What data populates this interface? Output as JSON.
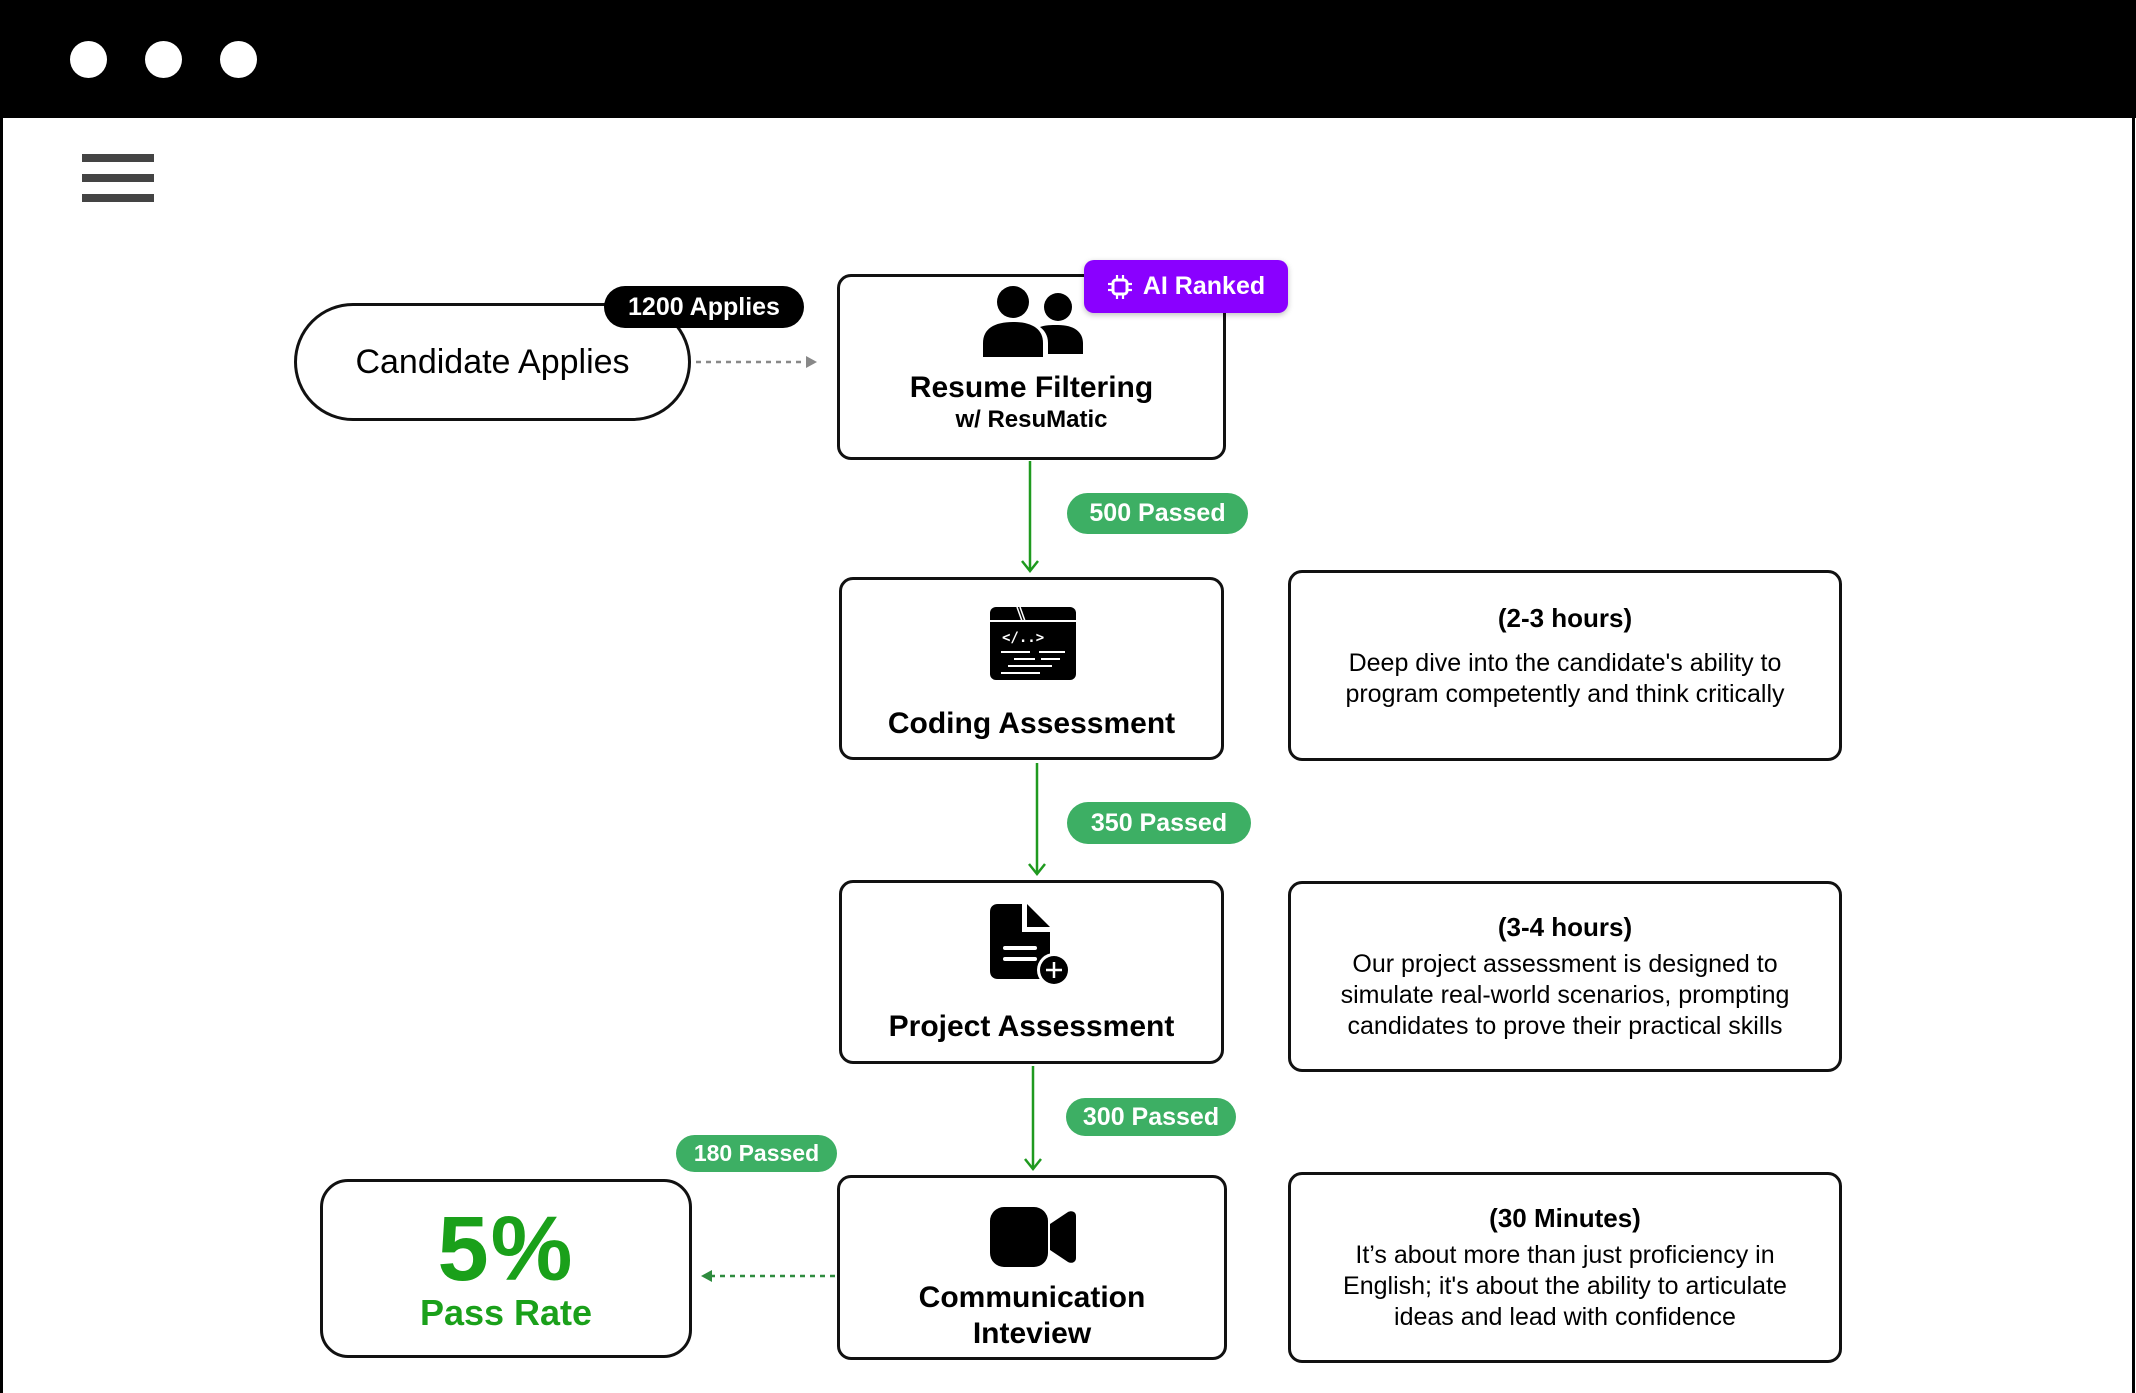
{
  "window": {
    "controls": [
      "window-dot",
      "window-dot",
      "window-dot"
    ],
    "menu_icon": "hamburger-menu-icon"
  },
  "flow": {
    "start": {
      "label": "Candidate Applies",
      "badge": "1200 Applies"
    },
    "steps": [
      {
        "title": "Resume Filtering",
        "subtitle": "w/ ResuMatic",
        "icon": "users-icon",
        "badge": {
          "icon": "chip-icon",
          "label": "AI Ranked",
          "color": "#8a00ff"
        }
      },
      {
        "title": "Coding Assessment",
        "icon": "code-window-icon",
        "code_glyph": "</..>"
      },
      {
        "title": "Project Assessment",
        "icon": "document-add-icon"
      },
      {
        "title": "Communication",
        "title_line2": "Inteview",
        "icon": "video-camera-icon"
      }
    ],
    "transitions": [
      {
        "label": "500 Passed"
      },
      {
        "label": "350 Passed"
      },
      {
        "label": "300 Passed"
      },
      {
        "label": "180 Passed"
      }
    ],
    "descriptions": [
      {
        "duration": "(2-3 hours)",
        "text": "Deep dive into the candidate's ability to program competently and think critically"
      },
      {
        "duration": "(3-4 hours)",
        "text": "Our project assessment is designed to simulate real-world scenarios, prompting candidates to prove their practical skills"
      },
      {
        "duration": "(30 Minutes)",
        "text": "It’s about more than just proficiency in English; it's about the ability to articulate ideas and lead with confidence"
      }
    ],
    "result": {
      "value": "5%",
      "label": "Pass Rate",
      "color": "#1aa01a"
    }
  },
  "colors": {
    "pass_badge": "#3daf64",
    "arrow_green": "#1f9a1f",
    "ai_badge": "#8a00ff"
  }
}
